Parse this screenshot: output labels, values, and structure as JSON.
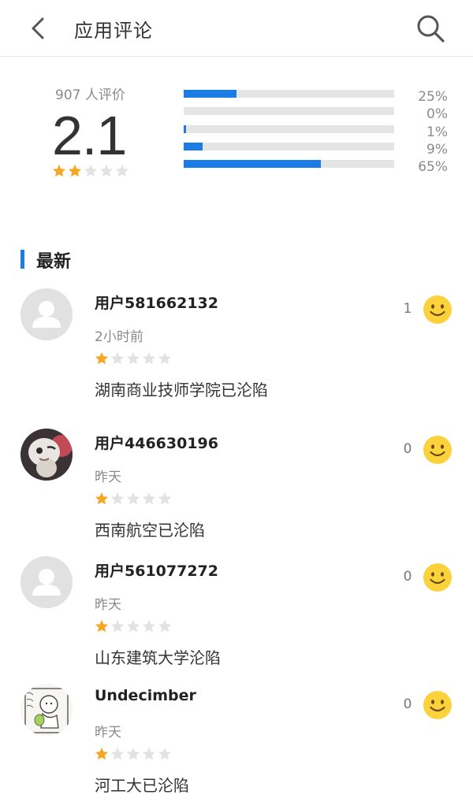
{
  "header": {
    "title": "应用评论",
    "back_icon": "chevron-left-icon",
    "search_icon": "search-icon"
  },
  "summary": {
    "count_text": "907 人评价",
    "score": "2.1",
    "stars_filled": 2,
    "stars_total": 5,
    "distribution": [
      {
        "percent_label": "25%",
        "fraction": 0.25
      },
      {
        "percent_label": "0%",
        "fraction": 0.0
      },
      {
        "percent_label": "1%",
        "fraction": 0.01
      },
      {
        "percent_label": "9%",
        "fraction": 0.09
      },
      {
        "percent_label": "65%",
        "fraction": 0.65
      }
    ]
  },
  "section": {
    "title": "最新"
  },
  "reviews": [
    {
      "username": "用户581662132",
      "time": "2小时前",
      "stars": 1,
      "content": "湖南商业技师学院已沦陷",
      "likes": "1",
      "avatar": "default-avatar"
    },
    {
      "username": "用户446630196",
      "time": "昨天",
      "stars": 1,
      "content": "西南航空已沦陷",
      "likes": "0",
      "avatar": "photo-avatar"
    },
    {
      "username": "用户561077272",
      "time": "昨天",
      "stars": 1,
      "content": "山东建筑大学沦陷",
      "likes": "0",
      "avatar": "default-avatar"
    },
    {
      "username": "Undecimber",
      "time": "昨天",
      "stars": 1,
      "content": "河工大已沦陷",
      "likes": "0",
      "avatar": "sketch-avatar"
    }
  ],
  "colors": {
    "accent": "#1a7de6",
    "star_filled": "#f5a623",
    "star_empty": "#e2e2e2",
    "smile": "#fbd23c"
  }
}
